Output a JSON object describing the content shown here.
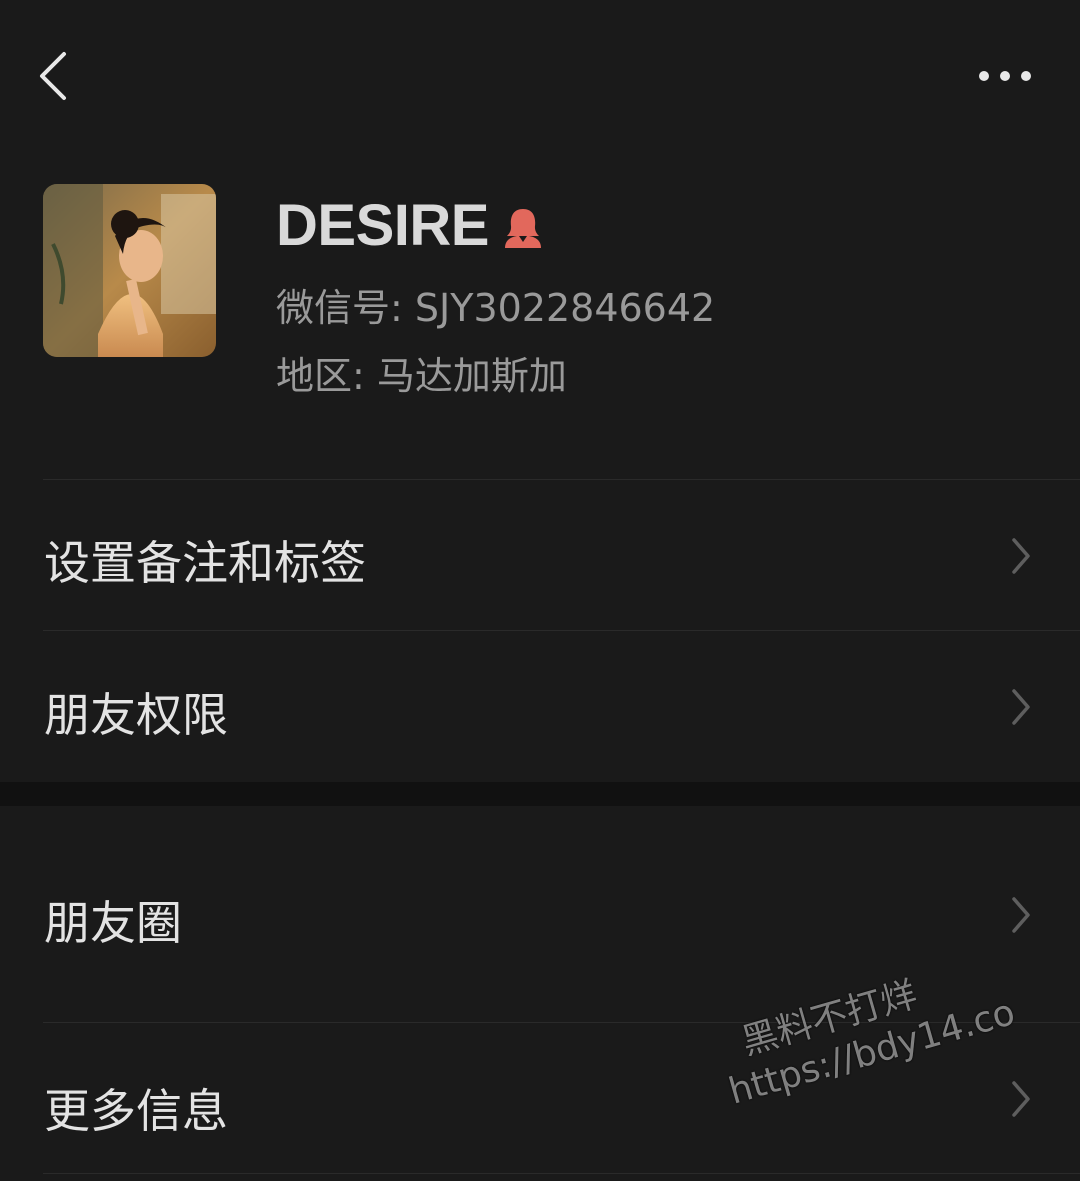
{
  "profile": {
    "name": "DESIRE",
    "wechat_id_label": "微信号:",
    "wechat_id_value": "SJY3022846642",
    "region_label": "地区:",
    "region_value": "马达加斯加",
    "gender_icon": "female-icon",
    "gender_icon_color": "#e2685c"
  },
  "menu": {
    "items": [
      {
        "label": "设置备注和标签"
      },
      {
        "label": "朋友权限"
      },
      {
        "label": "朋友圈"
      },
      {
        "label": "更多信息"
      }
    ]
  },
  "watermark": {
    "line1": "黑料不打烊",
    "line2": "https://bdy14.co"
  },
  "colors": {
    "background": "#1a1a1a",
    "section_gap": "#111111",
    "text_primary": "#e3e3e3",
    "text_secondary": "#9a9a9a"
  }
}
